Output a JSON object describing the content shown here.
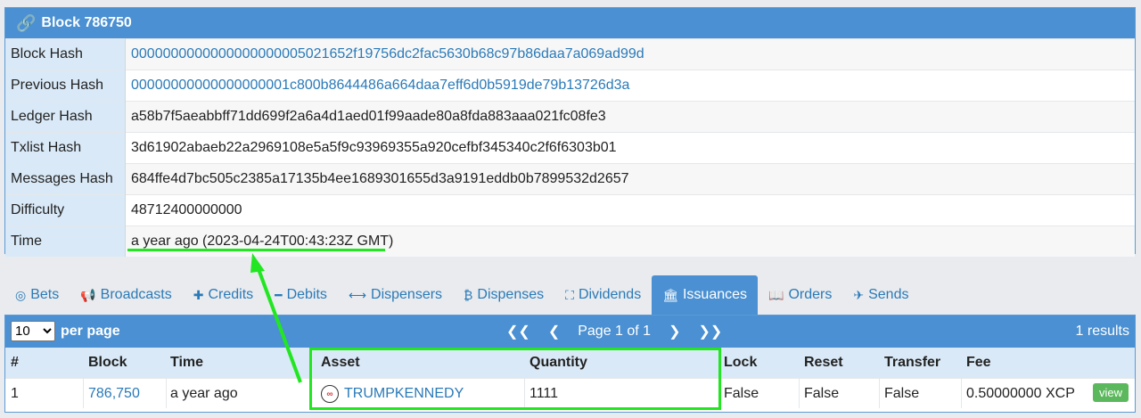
{
  "block": {
    "title": "Block 786750",
    "rows": [
      {
        "label": "Block Hash",
        "value": "0000000000000000000005021652f19756dc2fac5630b68c97b86daa7a069ad99d",
        "link": true
      },
      {
        "label": "Previous Hash",
        "value": "00000000000000000001c800b8644486a664daa7eff6d0b5919de79b13726d3a",
        "link": true
      },
      {
        "label": "Ledger Hash",
        "value": "a58b7f5aeabbff71dd699f2a6a4d1aed01f99aade80a8fda883aaa021fc08fe3",
        "link": false
      },
      {
        "label": "Txlist Hash",
        "value": "3d61902abaeb22a2969108e5a5f9c93969355a920cefbf345340c2f6f6303b01",
        "link": false
      },
      {
        "label": "Messages Hash",
        "value": "684ffe4d7bc505c2385a17135b4ee1689301655d3a9191eddb0b7899532d2657",
        "link": false
      },
      {
        "label": "Difficulty",
        "value": "48712400000000",
        "link": false
      },
      {
        "label": "Time",
        "value": "a year ago (2023-04-24T00:43:23Z GMT)",
        "link": false
      }
    ]
  },
  "tabs": [
    {
      "label": "Bets",
      "icon": "◎"
    },
    {
      "label": "Broadcasts",
      "icon": "📢"
    },
    {
      "label": "Credits",
      "icon": "✚"
    },
    {
      "label": "Debits",
      "icon": "━"
    },
    {
      "label": "Dispensers",
      "icon": "⟷"
    },
    {
      "label": "Dispenses",
      "icon": "₿"
    },
    {
      "label": "Dividends",
      "icon": "⛶"
    },
    {
      "label": "Issuances",
      "icon": "🏛"
    },
    {
      "label": "Orders",
      "icon": "📖"
    },
    {
      "label": "Sends",
      "icon": "✈"
    }
  ],
  "active_tab": "Issuances",
  "table": {
    "per_page_value": "10",
    "per_page_label": "per page",
    "pager": {
      "first": "❮❮",
      "prev": "❮",
      "page": "Page 1 of 1",
      "next": "❯",
      "last": "❯❯"
    },
    "results": "1 results",
    "columns": [
      "#",
      "Block",
      "Time",
      "Asset",
      "Quantity",
      "Lock",
      "Reset",
      "Transfer",
      "Fee"
    ],
    "row": {
      "num": "1",
      "block": "786,750",
      "time": "a year ago",
      "asset": "TRUMPKENNEDY",
      "quantity": "1111",
      "lock": "False",
      "reset": "False",
      "transfer": "False",
      "fee": "0.50000000 XCP",
      "action": "view"
    }
  },
  "colors": {
    "header": "#4a90d2",
    "highlight": "#22e622",
    "link": "#2a7ab8"
  }
}
